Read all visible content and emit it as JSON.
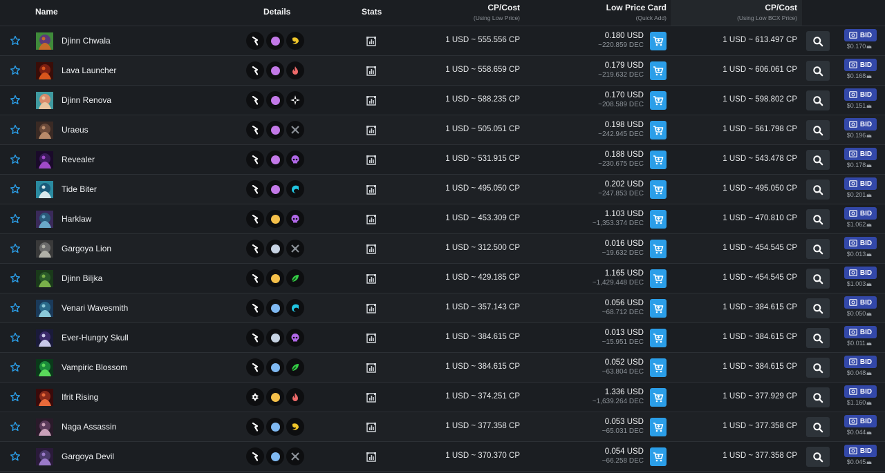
{
  "header": {
    "name": "Name",
    "details": "Details",
    "stats": "Stats",
    "cp_cost": "CP/Cost",
    "cp_cost_sub": "(Using Low Price)",
    "low_price": "Low Price Card",
    "low_price_sub": "(Quick Add)",
    "cp_cost2": "CP/Cost",
    "cp_cost2_sub": "(Using Low BCX Price)"
  },
  "bid_label": "BID",
  "colors": {
    "accent_blue": "#2b9ee8",
    "bid_blue": "#3348a8",
    "purple": "#c379e8",
    "gold": "#f5c04a",
    "silver": "#c7d3e3",
    "blue": "#7fb9f2",
    "fire": "#ef6a6a",
    "death": "#b168e8",
    "water": "#21c4e0",
    "earth": "#33cc44",
    "life": "#ffffff",
    "neutral": "#8a8f96",
    "dragon": "#f0c62a"
  },
  "rows": [
    {
      "name": "Djinn Chwala",
      "rarity": "purple",
      "element": "dragon",
      "cp_low": "1 USD ~ 555.556 CP",
      "price": "0.180 USD",
      "dec": "~220.859 DEC",
      "cp_bcx": "1 USD ~ 613.497 CP",
      "bid_price": "$0.170",
      "art": [
        "#5a3a7a",
        "#c46b2a",
        "#3f8a3a"
      ]
    },
    {
      "name": "Lava Launcher",
      "rarity": "purple",
      "element": "fire",
      "cp_low": "1 USD ~ 558.659 CP",
      "price": "0.179 USD",
      "dec": "~219.632 DEC",
      "cp_bcx": "1 USD ~ 606.061 CP",
      "bid_price": "$0.168",
      "art": [
        "#7a1f12",
        "#d8551c",
        "#3a0d08"
      ]
    },
    {
      "name": "Djinn Renova",
      "rarity": "purple",
      "element": "life",
      "cp_low": "1 USD ~ 588.235 CP",
      "price": "0.170 USD",
      "dec": "~208.589 DEC",
      "cp_bcx": "1 USD ~ 598.802 CP",
      "bid_price": "$0.151",
      "art": [
        "#d88a6a",
        "#e9c5a0",
        "#3f9aa0"
      ]
    },
    {
      "name": "Uraeus",
      "rarity": "purple",
      "element": "neutral",
      "cp_low": "1 USD ~ 505.051 CP",
      "price": "0.198 USD",
      "dec": "~242.945 DEC",
      "cp_bcx": "1 USD ~ 561.798 CP",
      "bid_price": "$0.196",
      "art": [
        "#6a4a3a",
        "#b88a6a",
        "#3a2a24"
      ]
    },
    {
      "name": "Revealer",
      "rarity": "purple",
      "element": "death",
      "cp_low": "1 USD ~ 531.915 CP",
      "price": "0.188 USD",
      "dec": "~230.675 DEC",
      "cp_bcx": "1 USD ~ 543.478 CP",
      "bid_price": "$0.178",
      "art": [
        "#3a1a5a",
        "#a04ac8",
        "#1a0a2a"
      ]
    },
    {
      "name": "Tide Biter",
      "rarity": "purple",
      "element": "water",
      "cp_low": "1 USD ~ 495.050 CP",
      "price": "0.202 USD",
      "dec": "~247.853 DEC",
      "cp_bcx": "1 USD ~ 495.050 CP",
      "bid_price": "$0.201",
      "art": [
        "#1a5a7a",
        "#d8e8ec",
        "#2a8aa0"
      ]
    },
    {
      "name": "Harklaw",
      "rarity": "gold",
      "element": "death",
      "cp_low": "1 USD ~ 453.309 CP",
      "price": "1.103 USD",
      "dec": "~1,353.374 DEC",
      "cp_bcx": "1 USD ~ 470.810 CP",
      "bid_price": "$1.062",
      "art": [
        "#2a5a7a",
        "#6aa8c8",
        "#3a2a5a"
      ]
    },
    {
      "name": "Gargoya Lion",
      "rarity": "silver",
      "element": "neutral",
      "cp_low": "1 USD ~ 312.500 CP",
      "price": "0.016 USD",
      "dec": "~19.632 DEC",
      "cp_bcx": "1 USD ~ 454.545 CP",
      "bid_price": "$0.013",
      "art": [
        "#6a6a6a",
        "#b0b0a8",
        "#3a3a3a"
      ]
    },
    {
      "name": "Djinn Biljka",
      "rarity": "gold",
      "element": "earth",
      "cp_low": "1 USD ~ 429.185 CP",
      "price": "1.165 USD",
      "dec": "~1,429.448 DEC",
      "cp_bcx": "1 USD ~ 454.545 CP",
      "bid_price": "$1.003",
      "art": [
        "#2a5a2a",
        "#7ab04a",
        "#1a3a1a"
      ]
    },
    {
      "name": "Venari Wavesmith",
      "rarity": "blue",
      "element": "water",
      "cp_low": "1 USD ~ 357.143 CP",
      "price": "0.056 USD",
      "dec": "~68.712 DEC",
      "cp_bcx": "1 USD ~ 384.615 CP",
      "bid_price": "$0.050",
      "art": [
        "#2a6a8a",
        "#8ac8d8",
        "#1a3a5a"
      ]
    },
    {
      "name": "Ever-Hungry Skull",
      "rarity": "silver",
      "element": "death",
      "cp_low": "1 USD ~ 384.615 CP",
      "price": "0.013 USD",
      "dec": "~15.951 DEC",
      "cp_bcx": "1 USD ~ 384.615 CP",
      "bid_price": "$0.011",
      "art": [
        "#3a2a6a",
        "#c8c8e8",
        "#1a1a3a"
      ]
    },
    {
      "name": "Vampiric Blossom",
      "rarity": "blue",
      "element": "earth",
      "cp_low": "1 USD ~ 384.615 CP",
      "price": "0.052 USD",
      "dec": "~63.804 DEC",
      "cp_bcx": "1 USD ~ 384.615 CP",
      "bid_price": "$0.048",
      "art": [
        "#1a8a3a",
        "#5ad85a",
        "#0a3a1a"
      ]
    },
    {
      "name": "Ifrit Rising",
      "rarity": "gold",
      "element": "fire",
      "cp_low": "1 USD ~ 374.251 CP",
      "price": "1.336 USD",
      "dec": "~1,639.264 DEC",
      "cp_bcx": "1 USD ~ 377.929 CP",
      "bid_price": "$1.160",
      "art": [
        "#8a2a1a",
        "#e86a3a",
        "#3a0a0a"
      ]
    },
    {
      "name": "Naga Assassin",
      "rarity": "blue",
      "element": "dragon",
      "cp_low": "1 USD ~ 377.358 CP",
      "price": "0.053 USD",
      "dec": "~65.031 DEC",
      "cp_bcx": "1 USD ~ 377.358 CP",
      "bid_price": "$0.044",
      "art": [
        "#5a3a5a",
        "#c8a0b8",
        "#2a1a2a"
      ]
    },
    {
      "name": "Gargoya Devil",
      "rarity": "blue",
      "element": "neutral",
      "cp_low": "1 USD ~ 370.370 CP",
      "price": "0.054 USD",
      "dec": "~66.258 DEC",
      "cp_bcx": "1 USD ~ 377.358 CP",
      "bid_price": "$0.045",
      "art": [
        "#4a3a6a",
        "#9a7ac8",
        "#2a1a3a"
      ]
    }
  ],
  "row_edition_icons": [
    "flag",
    "flag",
    "flag",
    "flag",
    "flag",
    "flag",
    "flag",
    "flag",
    "flag",
    "flag",
    "flag",
    "flag",
    "diamond",
    "flag",
    "flag"
  ]
}
